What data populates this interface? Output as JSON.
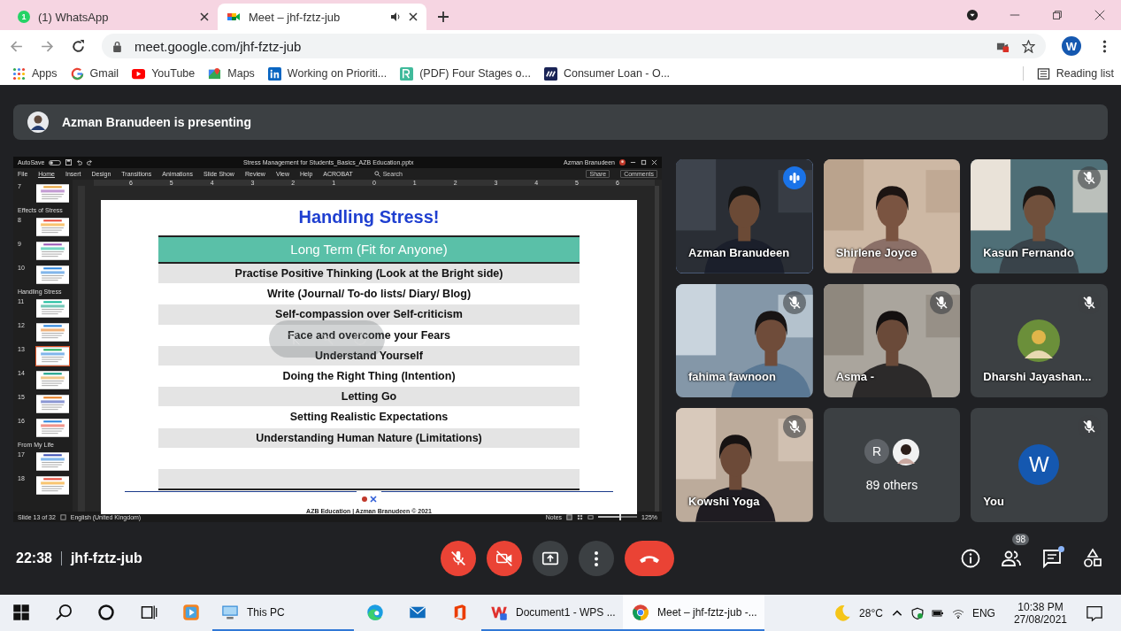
{
  "browser": {
    "tabs": [
      {
        "title": "(1) WhatsApp",
        "kind": "whatsapp",
        "badge": "1",
        "audio": false,
        "selected": false
      },
      {
        "title": "Meet – jhf-fztz-jub",
        "kind": "meet",
        "audio": true,
        "selected": true
      }
    ],
    "url": "meet.google.com/jhf-fztz-jub",
    "profile": "W",
    "bookmarks": [
      {
        "label": "Apps",
        "kind": "apps"
      },
      {
        "label": "Gmail",
        "kind": "google"
      },
      {
        "label": "YouTube",
        "kind": "youtube"
      },
      {
        "label": "Maps",
        "kind": "maps"
      },
      {
        "label": "Working on Prioriti...",
        "kind": "linkedin"
      },
      {
        "label": "(PDF) Four Stages o...",
        "kind": "research"
      },
      {
        "label": "Consumer Loan - O...",
        "kind": "loan"
      }
    ],
    "reading_list": "Reading list"
  },
  "meet": {
    "presenting": "Azman Branudeen is presenting",
    "presentation": {
      "autosave": "AutoSave",
      "autosave_on": false,
      "file": "Stress Management for Students_Basics_AZB Education.pptx",
      "user": "Azman Branudeen",
      "ribbon": [
        {
          "label": "File",
          "selected": false
        },
        {
          "label": "Home",
          "selected": true
        },
        {
          "label": "Insert",
          "selected": false
        },
        {
          "label": "Design",
          "selected": false
        },
        {
          "label": "Transitions",
          "selected": false
        },
        {
          "label": "Animations",
          "selected": false
        },
        {
          "label": "Slide Show",
          "selected": false
        },
        {
          "label": "Review",
          "selected": false
        },
        {
          "label": "View",
          "selected": false
        },
        {
          "label": "Help",
          "selected": false
        },
        {
          "label": "ACROBAT",
          "selected": false
        }
      ],
      "search": "Search",
      "share": "Share",
      "comments": "Comments",
      "ruler": [
        "6",
        "5",
        "4",
        "3",
        "2",
        "1",
        "0",
        "1",
        "2",
        "3",
        "4",
        "5",
        "6"
      ],
      "thumbnails": [
        {
          "kind": "slide",
          "number": "7",
          "selected": false
        },
        {
          "kind": "section",
          "label": "Effects of Stress"
        },
        {
          "kind": "slide",
          "number": "8",
          "selected": false
        },
        {
          "kind": "slide",
          "number": "9",
          "selected": false
        },
        {
          "kind": "slide",
          "number": "10",
          "selected": false
        },
        {
          "kind": "section",
          "label": "Handling Stress"
        },
        {
          "kind": "slide",
          "number": "11",
          "selected": false
        },
        {
          "kind": "slide",
          "number": "12",
          "selected": false
        },
        {
          "kind": "slide",
          "number": "13",
          "selected": true
        },
        {
          "kind": "slide",
          "number": "14",
          "selected": false
        },
        {
          "kind": "slide",
          "number": "15",
          "selected": false
        },
        {
          "kind": "slide",
          "number": "16",
          "selected": false
        },
        {
          "kind": "section",
          "label": "From My Life"
        },
        {
          "kind": "slide",
          "number": "17",
          "selected": false
        },
        {
          "kind": "slide",
          "number": "18",
          "selected": false
        }
      ],
      "slide": {
        "title": "Handling Stress!",
        "header": "Long Term (Fit for Anyone)",
        "rows": [
          "Practise Positive Thinking (Look at the Bright side)",
          "Write (Journal/ To-do lists/ Diary/ Blog)",
          "Self-compassion over Self-criticism",
          "Face and overcome your Fears",
          "Understand Yourself",
          "Doing the Right Thing (Intention)",
          "Letting Go",
          "Setting Realistic Expectations",
          "Understanding Human Nature (Limitations)"
        ],
        "footer": "AZB Education | Azman Branudeen © 2021"
      },
      "status": {
        "slide": "Slide 13 of 32",
        "language": "English (United Kingdom)",
        "notes": "Notes",
        "zoom": "125%",
        "zoom_slider": {
          "level": 0.55
        }
      }
    },
    "tiles": [
      {
        "name": "Azman Branudeen",
        "kind": "video",
        "muted": false,
        "speaking": true
      },
      {
        "name": "Shirlene Joyce",
        "kind": "video",
        "muted": false,
        "speaking": false
      },
      {
        "name": "Kasun Fernando",
        "kind": "video",
        "muted": true,
        "speaking": false
      },
      {
        "name": "fahima fawnoon",
        "kind": "video",
        "muted": true,
        "speaking": false
      },
      {
        "name": "Asma -",
        "kind": "video",
        "muted": true,
        "speaking": false
      },
      {
        "name": "Dharshi Jayashan...",
        "kind": "avatar",
        "muted": true,
        "speaking": false
      },
      {
        "name": "Kowshi Yoga",
        "kind": "video",
        "muted": true,
        "speaking": false
      },
      {
        "name": "89 others",
        "kind": "group",
        "letter": "R",
        "muted": false,
        "speaking": false
      },
      {
        "name": "You",
        "kind": "self",
        "letter": "W",
        "muted": true,
        "speaking": false
      }
    ],
    "clock": "22:38",
    "meeting_code": "jhf-fztz-jub",
    "controls": [
      {
        "kind": "mic",
        "on": false
      },
      {
        "kind": "camera",
        "on": false
      },
      {
        "kind": "present"
      },
      {
        "kind": "more"
      },
      {
        "kind": "end"
      }
    ],
    "side_controls": [
      {
        "kind": "info"
      },
      {
        "kind": "people",
        "badge": "98"
      },
      {
        "kind": "chat",
        "unread": true
      },
      {
        "kind": "activities"
      }
    ]
  },
  "taskbar": {
    "apps": [
      {
        "kind": "start",
        "open": false,
        "selected": false
      },
      {
        "kind": "search",
        "open": false,
        "selected": false
      },
      {
        "kind": "cortana",
        "open": false,
        "selected": false
      },
      {
        "kind": "taskview",
        "open": false,
        "selected": false
      },
      {
        "kind": "media",
        "open": false,
        "selected": false
      },
      {
        "kind": "explorer",
        "label": "This PC",
        "open": true,
        "selected": false
      },
      {
        "kind": "edge",
        "open": false,
        "selected": false
      },
      {
        "kind": "mail",
        "open": false,
        "selected": false
      },
      {
        "kind": "office",
        "open": false,
        "selected": false
      },
      {
        "kind": "wps",
        "label": "Document1 - WPS ...",
        "open": true,
        "selected": false
      },
      {
        "kind": "chrome",
        "label": "Meet – jhf-fztz-jub -...",
        "open": true,
        "selected": true
      }
    ],
    "weather": "28°C",
    "language": "ENG",
    "time": "10:38 PM",
    "date": "27/08/2021"
  }
}
